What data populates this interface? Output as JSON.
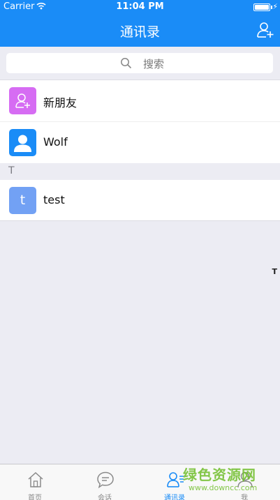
{
  "status_bar": {
    "carrier": "Carrier",
    "time": "11:04 PM",
    "battery_level": 1.0
  },
  "nav": {
    "title": "通讯录",
    "add_icon": "add-contact-icon"
  },
  "search": {
    "label": "搜索",
    "icon": "search-icon"
  },
  "contacts": [
    {
      "name": "新朋友",
      "icon": "add-friend-icon"
    },
    {
      "name": "Wolf",
      "icon": "person-avatar-icon"
    }
  ],
  "sections": [
    {
      "letter": "T",
      "items": [
        {
          "name": "test",
          "initial": "t"
        }
      ]
    }
  ],
  "index": [
    "T"
  ],
  "tabs": [
    {
      "label": "首页",
      "icon": "home-icon"
    },
    {
      "label": "会话",
      "icon": "chat-icon"
    },
    {
      "label": "通讯录",
      "icon": "contacts-icon",
      "active": true
    },
    {
      "label": "我",
      "icon": "me-icon"
    }
  ],
  "watermark": {
    "text_cn": "绿色资源网",
    "text_en": "www.downcc.com"
  },
  "colors": {
    "accent": "#1a8cf7",
    "friend_avatar": "#d66cf3",
    "test_avatar": "#72a1f4",
    "watermark": "#6fbe2a"
  }
}
